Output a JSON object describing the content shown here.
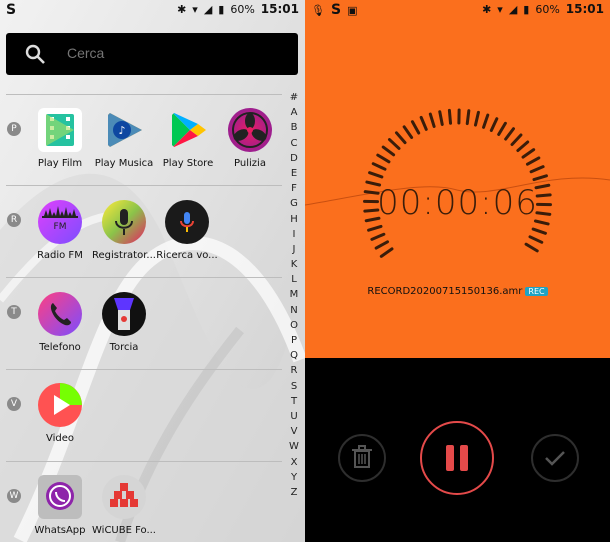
{
  "left": {
    "status": {
      "battery": "60%",
      "time": "15:01"
    },
    "search": {
      "placeholder": "Cerca"
    },
    "sections": [
      {
        "letter": "P",
        "apps": [
          "Play Film",
          "Play Musica",
          "Play Store",
          "Pulizia"
        ]
      },
      {
        "letter": "R",
        "apps": [
          "Radio FM",
          "Registrator...",
          "Ricerca vo..."
        ]
      },
      {
        "letter": "T",
        "apps": [
          "Telefono",
          "Torcia"
        ]
      },
      {
        "letter": "V",
        "apps": [
          "Video"
        ]
      },
      {
        "letter": "W",
        "apps": [
          "WhatsApp",
          "WiCUBE Fo..."
        ]
      }
    ],
    "radio_fm_badge": "FM",
    "alphabet": [
      "#",
      "A",
      "B",
      "C",
      "D",
      "E",
      "F",
      "G",
      "H",
      "I",
      "J",
      "K",
      "L",
      "M",
      "N",
      "O",
      "P",
      "Q",
      "R",
      "S",
      "T",
      "U",
      "V",
      "W",
      "X",
      "Y",
      "Z"
    ]
  },
  "right": {
    "status": {
      "battery": "60%",
      "time": "15:01"
    },
    "timer": "00:00:06",
    "filename": "RECORD20200715150136.amr",
    "rec_badge": "REC"
  },
  "colors": {
    "recorder_orange": "#fb6f1d",
    "pause_red": "#e44a4a"
  }
}
